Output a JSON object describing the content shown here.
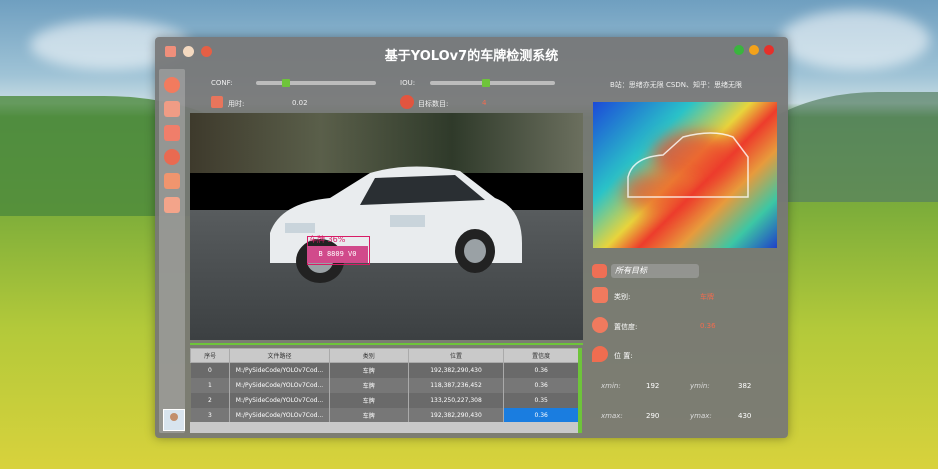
{
  "window": {
    "title": "基于YOLOv7的车牌检测系统",
    "credits": "B站：思绪亦无限  CSDN、知乎：思绪无限"
  },
  "controls": {
    "conf_label": "CONF:",
    "conf_value": 0.25,
    "iou_label": "IOU:",
    "iou_value": 0.45,
    "time_label": "用时:",
    "time_value": "0.02",
    "count_label": "目标数目:",
    "count_value": "4"
  },
  "detection_overlay": {
    "label": "车牌 36%",
    "plate_text": "B 8809 V0"
  },
  "results": {
    "selector_placeholder": "所有目标",
    "type_label": "类别:",
    "type_value": "车牌",
    "conf_label": "置信度:",
    "conf_value": "0.36",
    "pos_label": "位 置:",
    "xmin_label": "xmin:",
    "xmin_value": "192",
    "ymin_label": "ymin:",
    "ymin_value": "382",
    "xmax_label": "xmax:",
    "xmax_value": "290",
    "ymax_label": "ymax:",
    "ymax_value": "430"
  },
  "table": {
    "headers": [
      "序号",
      "文件路径",
      "类别",
      "位置",
      "置信度"
    ],
    "rows": [
      [
        "0",
        "M:/PySideCode/YOLOv7Cod...",
        "车牌",
        "192,382,290,430",
        "0.36"
      ],
      [
        "1",
        "M:/PySideCode/YOLOv7Cod...",
        "车牌",
        "118,387,236,452",
        "0.36"
      ],
      [
        "2",
        "M:/PySideCode/YOLOv7Cod...",
        "车牌",
        "133,250,227,308",
        "0.35"
      ],
      [
        "3",
        "M:/PySideCode/YOLOv7Cod...",
        "车牌",
        "192,382,290,430",
        "0.36"
      ]
    ]
  },
  "colors": {
    "accent_green": "#6ec43a",
    "selected_row": "#1a7de0",
    "value_red": "#f26c4f"
  }
}
